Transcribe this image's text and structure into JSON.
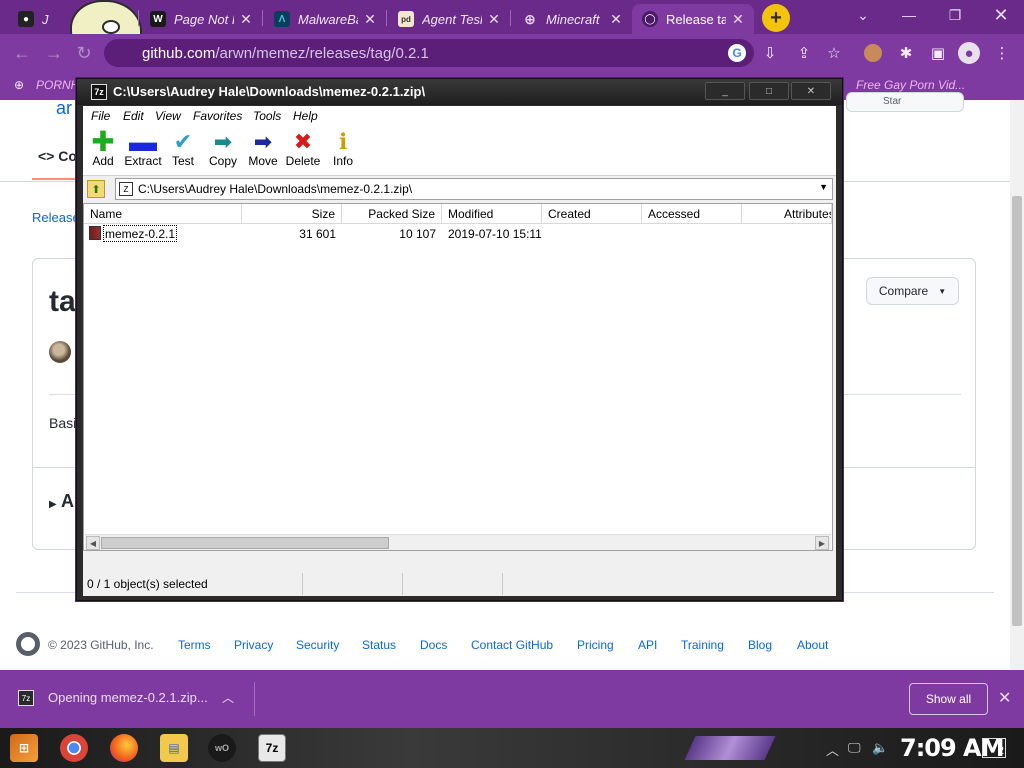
{
  "browser": {
    "tabs": [
      {
        "title": "J",
        "favicon": "owl-icon",
        "active": false
      },
      {
        "title": "Page Not F",
        "favicon": "wordpress-icon",
        "active": false
      },
      {
        "title": "MalwareBaz",
        "favicon": "malwarebazaar-icon",
        "active": false
      },
      {
        "title": "Agent Tesla",
        "favicon": "malpedia-icon",
        "active": false
      },
      {
        "title": "Minecraft",
        "favicon": "globe-icon",
        "active": false
      },
      {
        "title": "Release ta",
        "favicon": "github-icon",
        "active": true
      }
    ],
    "url_host": "github.com",
    "url_path": "/arwn/memez/releases/tag/0.2.1",
    "bookmarks": [
      "PORNH",
      "Free Gay Porn Vid..."
    ],
    "accent_color": "#7e3aa0"
  },
  "github": {
    "repo_fragment": "ar",
    "star_label": "Star",
    "code_tab": "Co",
    "releases_link": "Releases",
    "tag_title": "ta",
    "compare_label": "Compare",
    "body_text": "Basi",
    "assets_label": "A",
    "footer": {
      "copyright": "© 2023 GitHub, Inc.",
      "links": [
        "Terms",
        "Privacy",
        "Security",
        "Status",
        "Docs",
        "Contact GitHub",
        "Pricing",
        "API",
        "Training",
        "Blog",
        "About"
      ]
    }
  },
  "sevenzip": {
    "title": "C:\\Users\\Audrey Hale\\Downloads\\memez-0.2.1.zip\\",
    "title_icon": "7z",
    "menu": [
      "File",
      "Edit",
      "View",
      "Favorites",
      "Tools",
      "Help"
    ],
    "toolbar": [
      {
        "label": "Add",
        "icon": "plus-icon",
        "color": "#1faa1f"
      },
      {
        "label": "Extract",
        "icon": "minus-icon",
        "color": "#1a2ad8"
      },
      {
        "label": "Test",
        "icon": "check-icon",
        "color": "#2aa0c8"
      },
      {
        "label": "Copy",
        "icon": "copy-arrow-icon",
        "color": "#1a8a8a"
      },
      {
        "label": "Move",
        "icon": "move-arrow-icon",
        "color": "#1a2a9a"
      },
      {
        "label": "Delete",
        "icon": "delete-x-icon",
        "color": "#d81a1a"
      },
      {
        "label": "Info",
        "icon": "info-icon",
        "color": "#c8a000"
      }
    ],
    "path": "C:\\Users\\Audrey Hale\\Downloads\\memez-0.2.1.zip\\",
    "columns": [
      "Name",
      "Size",
      "Packed Size",
      "Modified",
      "Created",
      "Accessed",
      "Attributes"
    ],
    "files": [
      {
        "name": "memez-0.2.1",
        "size": "31 601",
        "packed_size": "10 107",
        "modified": "2019-07-10 15:11",
        "created": "",
        "accessed": "",
        "attributes": ""
      }
    ],
    "status": "0 / 1 object(s) selected"
  },
  "downloads": {
    "item_text": "Opening memez-0.2.1.zip...",
    "show_all": "Show all"
  },
  "taskbar": {
    "clock": "7:09 AM",
    "notifications": "2"
  }
}
